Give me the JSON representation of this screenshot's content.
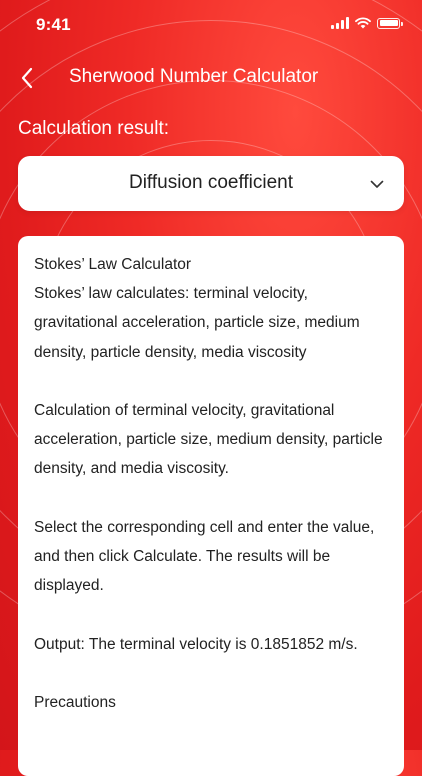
{
  "status_bar": {
    "time": "9:41",
    "icons": [
      "signal-icon",
      "wifi-icon",
      "battery-icon"
    ]
  },
  "header": {
    "back_icon": "chevron-left-icon",
    "title": "Sherwood Number Calculator"
  },
  "result_label": "Calculation result:",
  "selector": {
    "value": "Diffusion coefficient",
    "icon": "chevron-down-icon"
  },
  "info": {
    "title": "Stokes’ Law Calculator",
    "intro": "Stokes’ law calculates: terminal velocity, gravitational acceleration, particle size, medium density, particle density, media viscosity",
    "calc": "Calculation of terminal velocity, gravitational acceleration, particle size, medium density, particle density, and media viscosity.",
    "instructions": "Select the corresponding cell and enter the value, and then click Calculate. The results will be displayed.",
    "output": "Output: The terminal velocity is 0.1851852 m/s.",
    "precautions": "Precautions"
  },
  "colors": {
    "background": "#e8211f",
    "card": "#ffffff",
    "text_dark": "#222222"
  }
}
